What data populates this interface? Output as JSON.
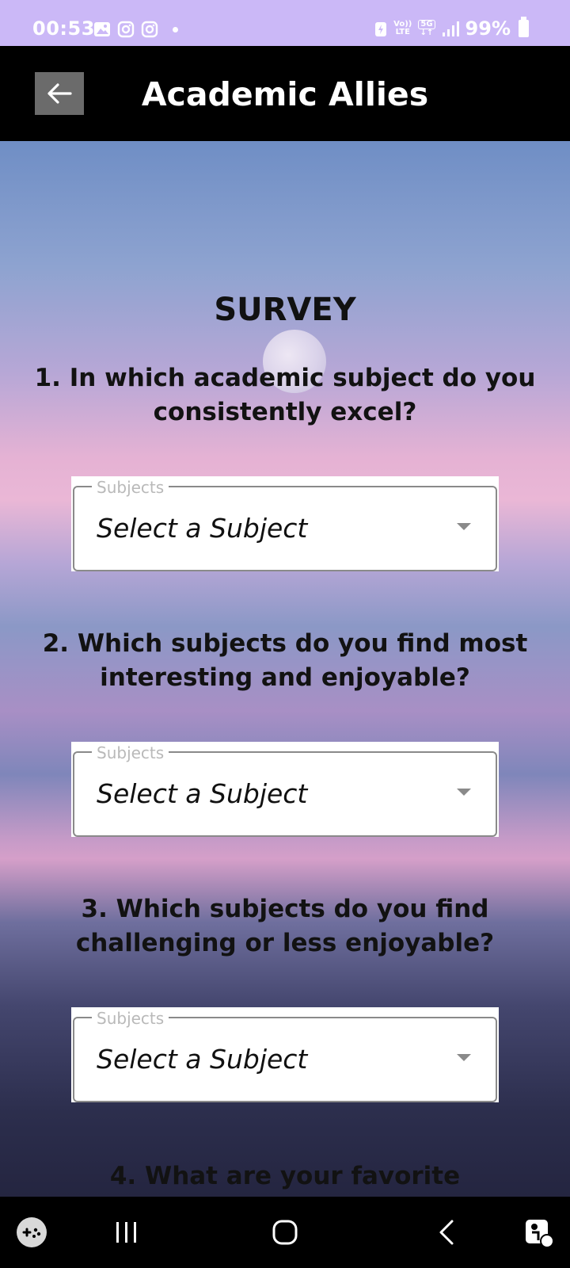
{
  "status_bar": {
    "time": "00:53",
    "network_top": "Vo))",
    "network_bottom": "LTE",
    "network_5g": "5G",
    "battery": "99%"
  },
  "app_bar": {
    "title": "Academic Allies"
  },
  "survey": {
    "title": "SURVEY",
    "questions": [
      {
        "text": "1. In which academic subject do you consistently excel?",
        "field_label": "Subjects",
        "value": "Select a Subject"
      },
      {
        "text": "2. Which subjects do you find most interesting and enjoyable?",
        "field_label": "Subjects",
        "value": "Select a Subject"
      },
      {
        "text": "3. Which subjects do you find challenging or less enjoyable?",
        "field_label": "Subjects",
        "value": "Select a Subject"
      },
      {
        "text": "4. What are your favorite"
      }
    ]
  },
  "icons": {
    "back": "arrow-left-icon",
    "recents": "recents-icon",
    "home": "home-icon",
    "back_nav": "chevron-left-icon",
    "game": "game-controller-icon",
    "accessibility": "accessibility-icon"
  },
  "colors": {
    "status_bar": "#cbb8f7",
    "app_bar": "#000000",
    "back_button": "#6b6b6b"
  }
}
